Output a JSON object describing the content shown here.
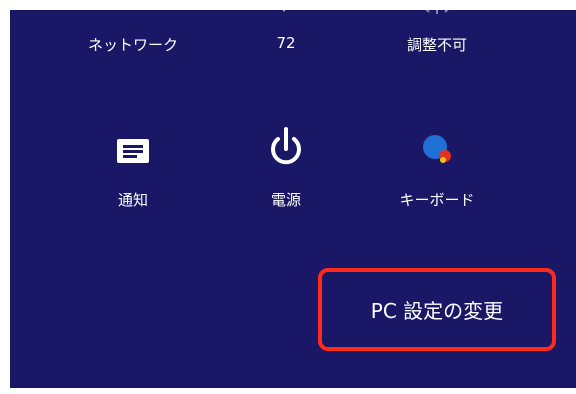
{
  "quick_settings": {
    "row1": {
      "network_label": "ネットワーク",
      "volume_label": "72",
      "brightness_label": "調整不可"
    },
    "row2": {
      "notifications_label": "通知",
      "power_label": "電源",
      "keyboard_label": "キーボード"
    }
  },
  "settings_link": {
    "label": "PC 設定の変更"
  },
  "colors": {
    "panel_bg": "#1a1866",
    "highlight_border": "#ff2a1a",
    "text": "#ffffff"
  },
  "icons": [
    "network-icon",
    "volume-icon",
    "brightness-icon",
    "notifications-icon",
    "power-icon",
    "keyboard-icon"
  ]
}
